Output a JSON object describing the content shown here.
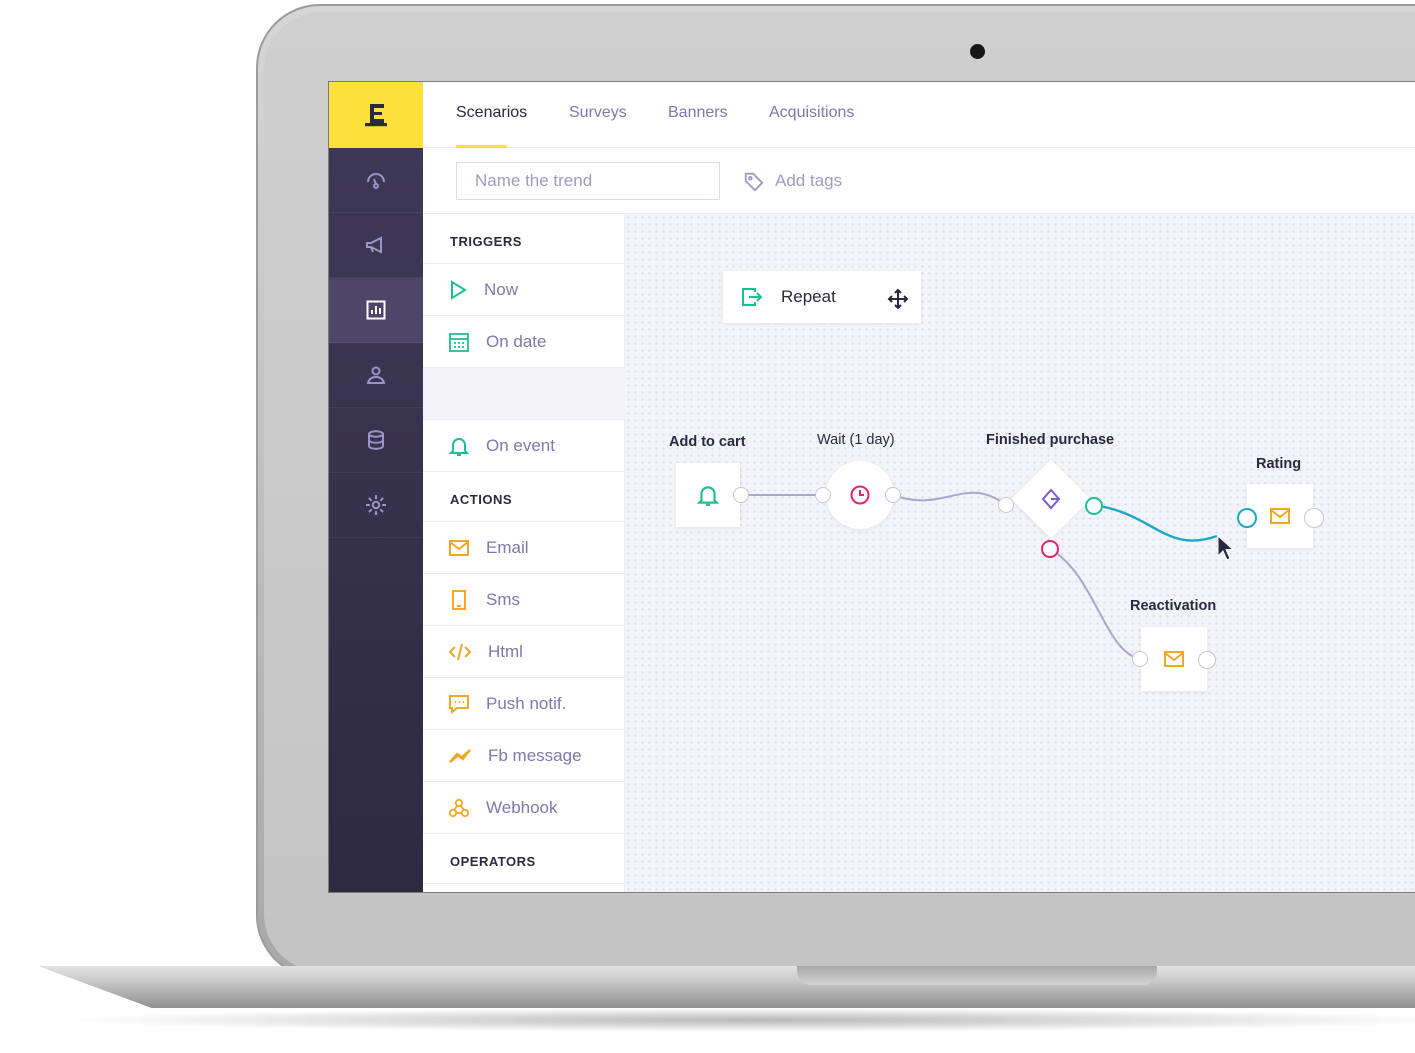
{
  "top_tabs": [
    {
      "label": "Scenarios",
      "active": true
    },
    {
      "label": "Surveys",
      "active": false
    },
    {
      "label": "Banners",
      "active": false
    },
    {
      "label": "Acquisitions",
      "active": false
    }
  ],
  "toolbar": {
    "name_placeholder": "Name the trend",
    "tags_label": "Add tags"
  },
  "sidebar_rail": {
    "items": [
      "dashboard-icon",
      "megaphone-icon",
      "chart-icon",
      "users-icon",
      "database-icon",
      "gear-icon"
    ],
    "active_index": 2
  },
  "palette": {
    "triggers_heading": "TRIGGERS",
    "triggers": [
      {
        "label": "Now",
        "icon": "play-icon"
      },
      {
        "label": "On date",
        "icon": "calendar-icon"
      },
      {
        "label": "On event",
        "icon": "bell-icon"
      }
    ],
    "actions_heading": "ACTIONS",
    "actions": [
      {
        "label": "Email",
        "icon": "email-icon"
      },
      {
        "label": "Sms",
        "icon": "phone-icon"
      },
      {
        "label": "Html",
        "icon": "code-icon"
      },
      {
        "label": "Push notif.",
        "icon": "chat-icon"
      },
      {
        "label": "Fb message",
        "icon": "messenger-icon"
      },
      {
        "label": "Webhook",
        "icon": "webhook-icon"
      }
    ],
    "operators_heading": "OPERATORS"
  },
  "canvas": {
    "floating_item": "Repeat",
    "nodes": {
      "add_to_cart": "Add to cart",
      "wait": "Wait (1 day)",
      "finished_purchase": "Finished purchase",
      "rating": "Rating",
      "reactivation": "Reactivation"
    }
  },
  "colors": {
    "brand_yellow": "#fde13b",
    "rail": "#3f3958",
    "green": "#1fbf8f",
    "teal": "#1ba8c9",
    "pink": "#e0266b",
    "orange": "#f5a623",
    "purple": "#7b5cd6",
    "link_purple": "#7d79a8"
  }
}
